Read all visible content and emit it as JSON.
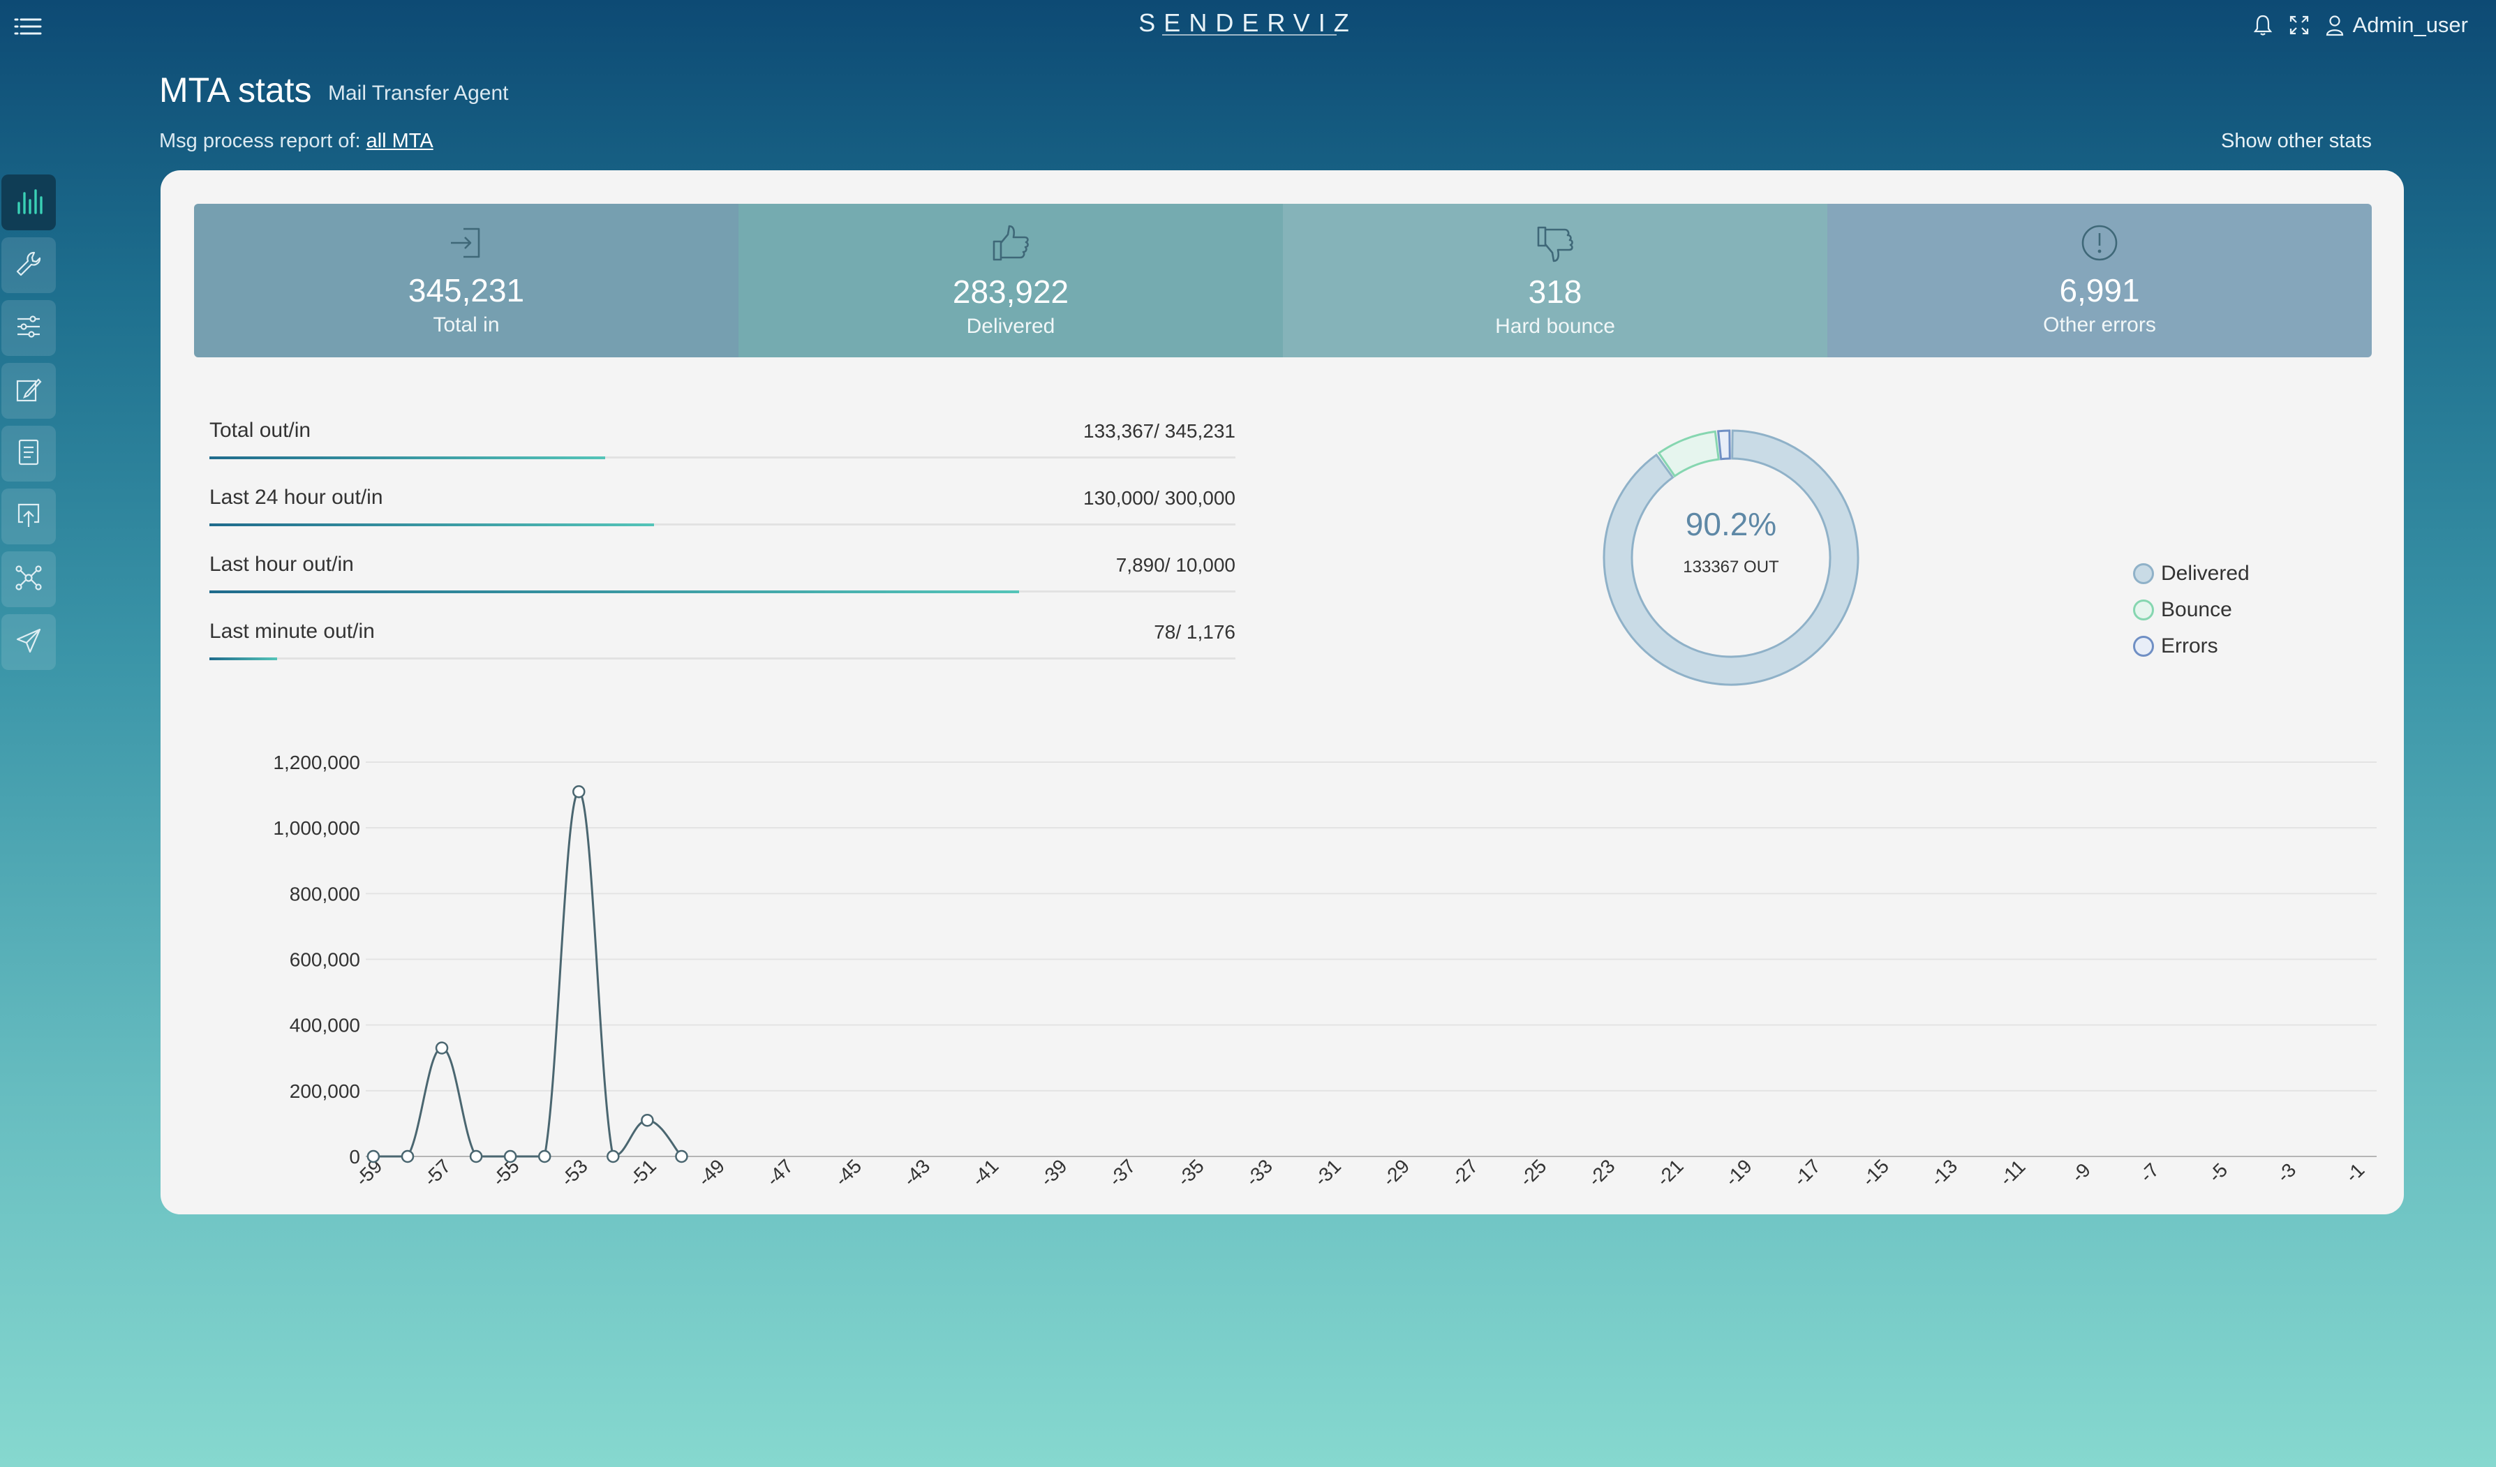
{
  "app": {
    "brand": "SENDERVIZ",
    "user": "Admin_user"
  },
  "header": {
    "title": "MTA stats",
    "subtitle": "Mail Transfer Agent",
    "report_prefix": "Msg process report of:",
    "report_link": "all MTA",
    "other_stats": "Show other stats"
  },
  "sidebar": {
    "items": [
      {
        "icon": "bar-chart-icon",
        "active": true
      },
      {
        "icon": "wrench-icon",
        "active": false
      },
      {
        "icon": "sliders-icon",
        "active": false
      },
      {
        "icon": "edit-icon",
        "active": false
      },
      {
        "icon": "document-icon",
        "active": false
      },
      {
        "icon": "upload-icon",
        "active": false
      },
      {
        "icon": "network-icon",
        "active": false
      },
      {
        "icon": "send-icon",
        "active": false
      }
    ]
  },
  "stats": [
    {
      "value": "345,231",
      "label": "Total in",
      "icon": "sign-in-icon",
      "color": "#769fb0"
    },
    {
      "value": "283,922",
      "label": "Delivered",
      "icon": "thumbs-up-icon",
      "color": "#75abb0"
    },
    {
      "value": "318",
      "label": "Hard bounce",
      "icon": "thumbs-down-icon",
      "color": "#85b3b9"
    },
    {
      "value": "6,991",
      "label": "Other errors",
      "icon": "alert-icon",
      "color": "#85a6bb"
    }
  ],
  "progress": [
    {
      "label": "Total out/in",
      "value": "133,367/ 345,231",
      "fraction": 0.386
    },
    {
      "label": "Last 24 hour out/in",
      "value": "130,000/ 300,000",
      "fraction": 0.433
    },
    {
      "label": "Last hour out/in",
      "value": "7,890/ 10,000",
      "fraction": 0.789
    },
    {
      "label": "Last minute out/in",
      "value": "78/ 1,176",
      "fraction": 0.066
    }
  ],
  "donut": {
    "percent": "90.2%",
    "out_label": "133367 OUT",
    "segments": [
      {
        "name": "Delivered",
        "fraction": 0.902,
        "color": "#c9dbe6",
        "stroke": "#8fb1c8"
      },
      {
        "name": "Bounce",
        "fraction": 0.08,
        "color": "#e6f5ee",
        "stroke": "#86d6b0"
      },
      {
        "name": "Errors",
        "fraction": 0.018,
        "color": "#e8eef8",
        "stroke": "#6f8fc4"
      }
    ],
    "legend": [
      "Delivered",
      "Bounce",
      "Errors"
    ]
  },
  "chart_data": {
    "type": "line",
    "x": [
      -59,
      -58,
      -57,
      -56,
      -55,
      -54,
      -53,
      -52,
      -51,
      -50
    ],
    "y": [
      0,
      0,
      330000,
      0,
      0,
      0,
      1110000,
      0,
      110000,
      0
    ],
    "xticks": [
      -59,
      -57,
      -55,
      -53,
      -51,
      -49,
      -47,
      -45,
      -43,
      -41,
      -39,
      -37,
      -35,
      -33,
      -31,
      -29,
      -27,
      -25,
      -23,
      -21,
      -19,
      -17,
      -15,
      -13,
      -11,
      -9,
      -7,
      -5,
      -3,
      -1
    ],
    "xlim": [
      -59.1,
      -0.5
    ],
    "ylim": [
      0,
      1200000
    ],
    "yticks": [
      0,
      200000,
      400000,
      600000,
      800000,
      1000000,
      1200000
    ],
    "ytick_labels": [
      "0",
      "200,000",
      "400,000",
      "600,000",
      "800,000",
      "1,000,000",
      "1,200,000"
    ],
    "grid": true,
    "line_color": "#4a6670"
  }
}
